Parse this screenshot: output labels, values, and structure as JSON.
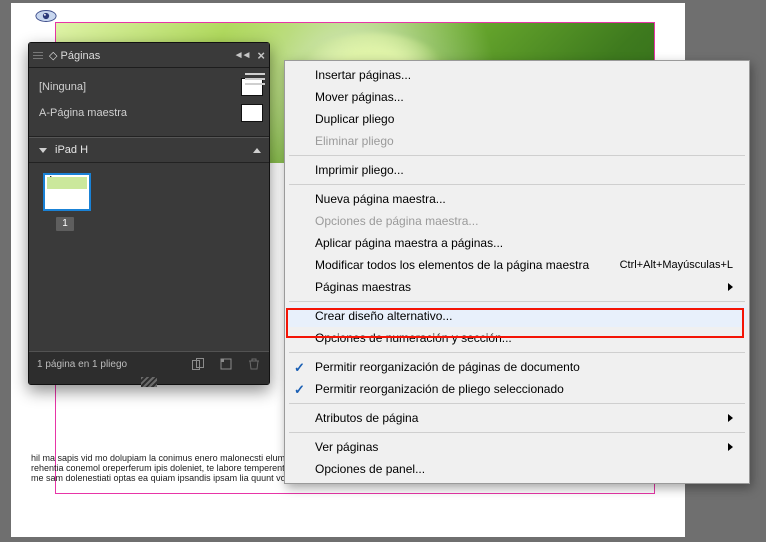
{
  "panel": {
    "title": "Páginas",
    "masters": [
      {
        "label": "[Ninguna]"
      },
      {
        "label": "A-Página maestra"
      }
    ],
    "layout_name": "iPad H",
    "page_letter": "A",
    "page_number": "1",
    "status": "1 página en 1 pliego"
  },
  "menu": {
    "insert_pages": "Insertar páginas...",
    "move_pages": "Mover páginas...",
    "duplicate_spread": "Duplicar pliego",
    "delete_spread": "Eliminar pliego",
    "print_spread": "Imprimir pliego...",
    "new_master": "Nueva página maestra...",
    "master_options": "Opciones de página maestra...",
    "apply_master": "Aplicar página maestra a páginas...",
    "override_all": "Modificar todos los elementos de la página maestra",
    "override_shortcut": "Ctrl+Alt+Mayúsculas+L",
    "master_pages": "Páginas maestras",
    "create_alt": "Crear diseño alternativo...",
    "numbering": "Opciones de numeración y sección...",
    "allow_doc_shuffle": "Permitir reorganización de páginas de documento",
    "allow_spread_shuffle": "Permitir reorganización de pliego seleccionado",
    "page_attributes": "Atributos de página",
    "view_pages": "Ver páginas",
    "panel_options": "Opciones de panel..."
  },
  "doc": {
    "lorem": "hil ma sapis vid mo dolupiam la conimus enero malonecsti elum latib reicate sam ipicatse. Magnitis et fugia volorup tationet vollest officis ulp utur, consed molorehentia conemol oreperferum ipis doleniet, te labore temperent utet omommolehit faccum iuntis elicquibe endiatur as re cum unt, sitaturio cuscit eost faces arme sam dolenestiati optas ea quiam ipsandis ipsam lia quunt volorem quis porenitas et amus."
  }
}
